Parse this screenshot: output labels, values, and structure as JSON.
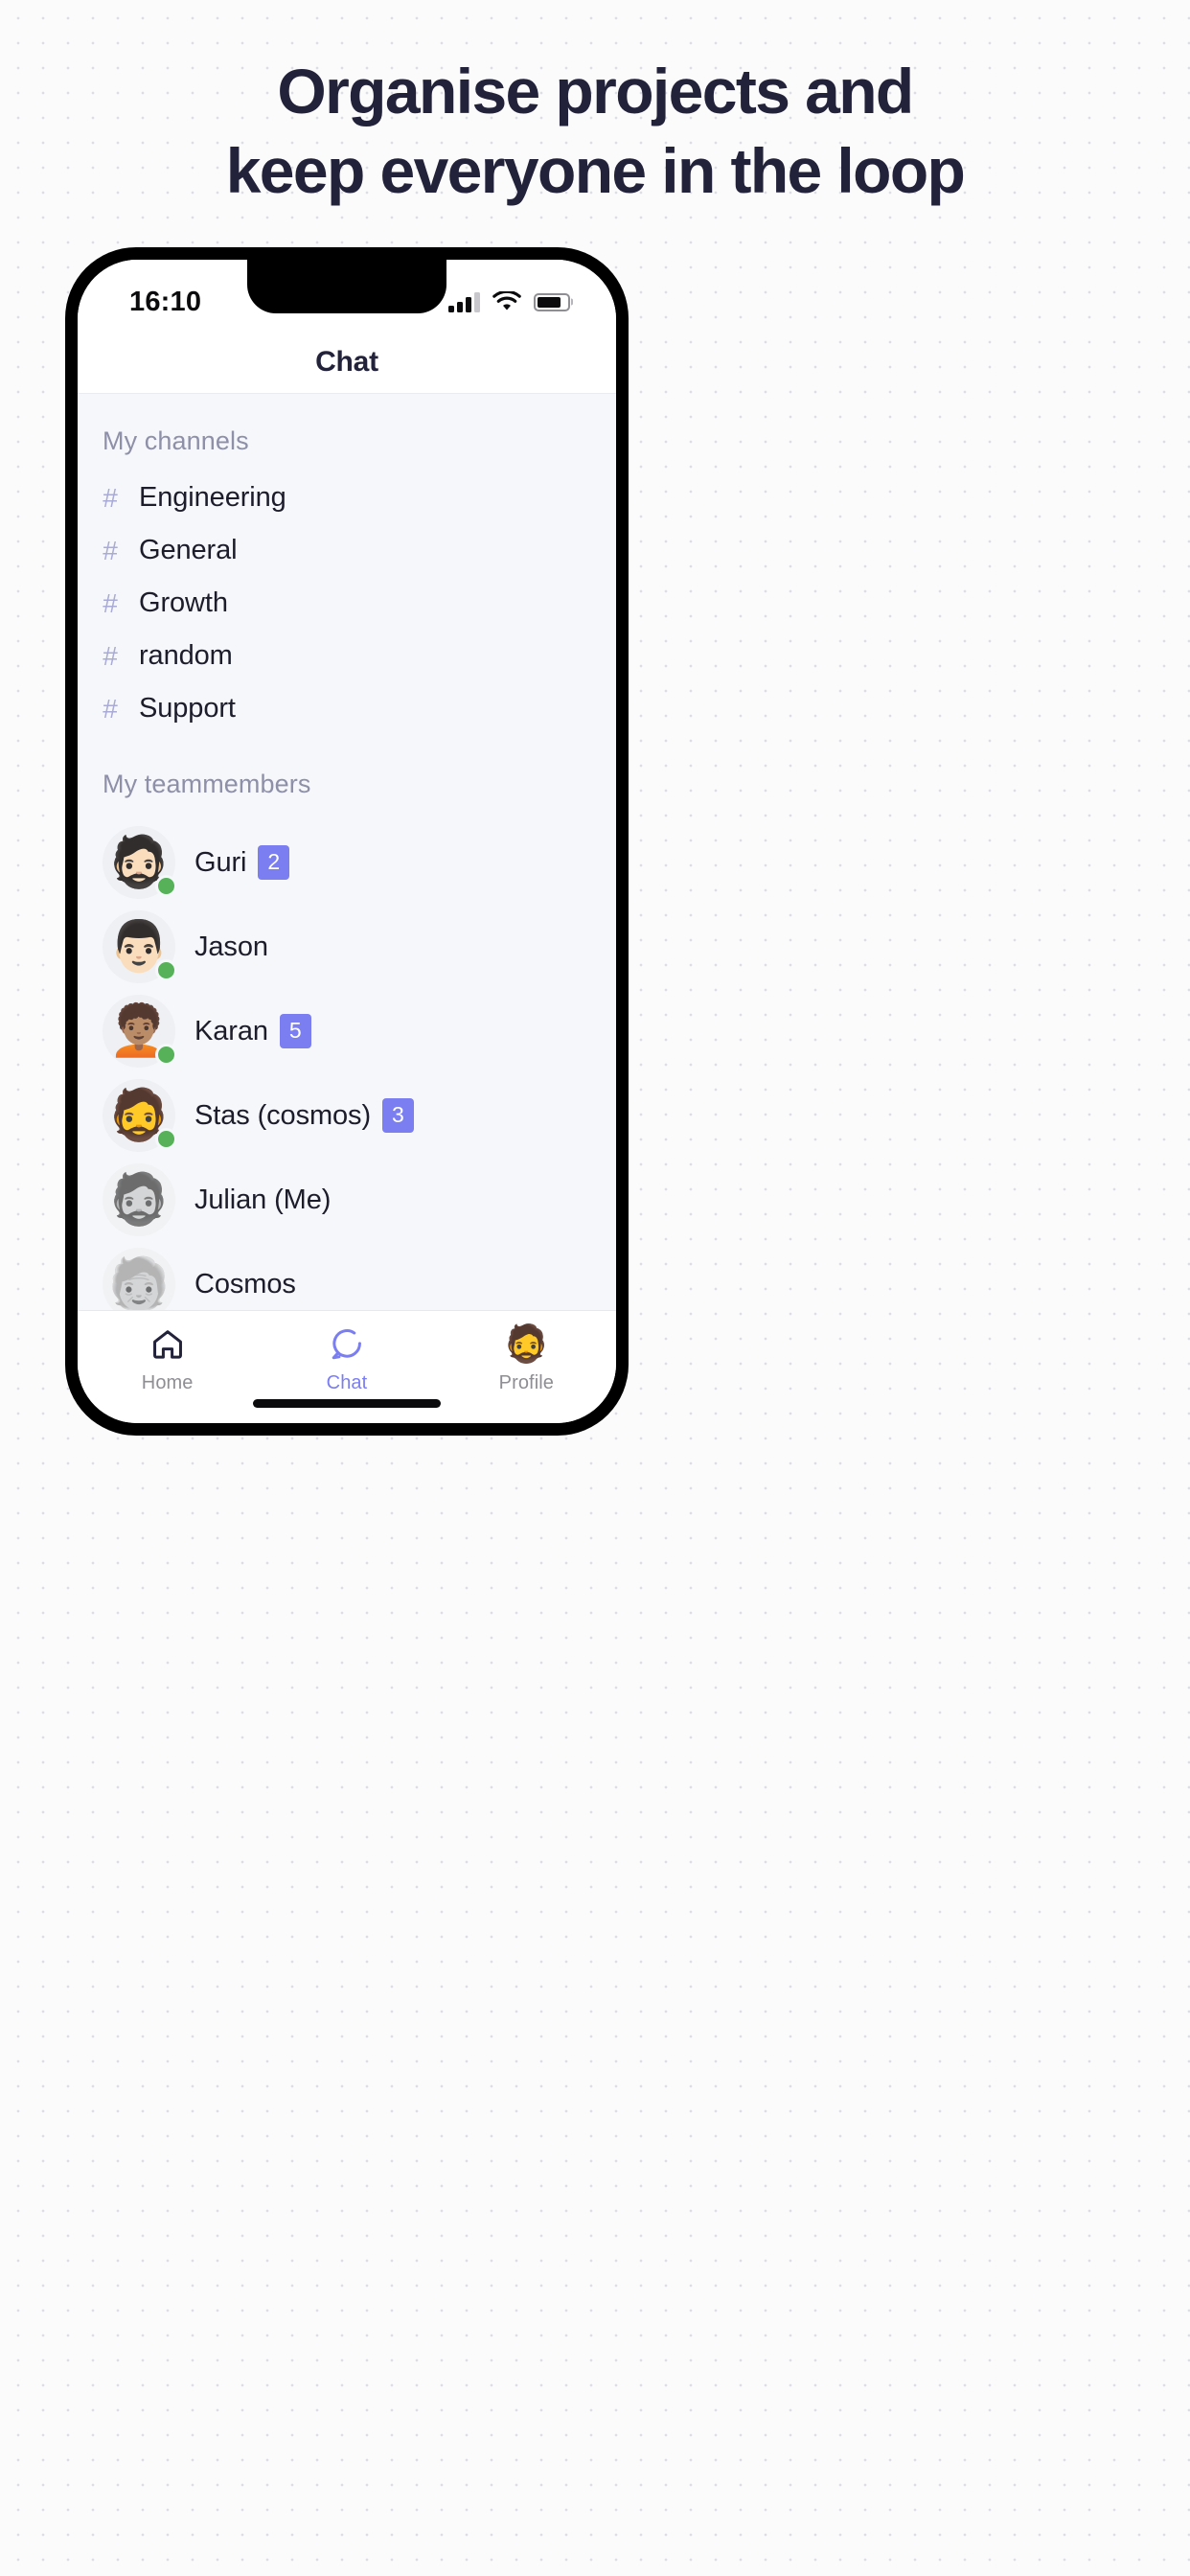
{
  "headline": {
    "line1": "Organise projects and",
    "line2": "keep everyone in the loop"
  },
  "colors": {
    "accent": "#7b7ef0",
    "headline_text": "#22223b",
    "content_bg": "#f5f7fb",
    "section_label": "#8e8fa8",
    "hash_icon": "#a9abd6",
    "online_dot": "#56b159",
    "badge_bg": "#7b7ef0",
    "page_bg": "#fbfbfc"
  },
  "status_bar": {
    "time": "16:10",
    "icons": [
      "signal-bars-icon",
      "wifi-icon",
      "battery-icon"
    ],
    "signal_bars_filled": 3,
    "signal_bars_total": 4,
    "battery_level_percent": 80
  },
  "nav": {
    "title": "Chat"
  },
  "sections": {
    "channels_label": "My channels",
    "teammembers_label": "My teammembers"
  },
  "channels": [
    {
      "icon": "hash-icon",
      "symbol": "#",
      "name": "Engineering"
    },
    {
      "icon": "hash-icon",
      "symbol": "#",
      "name": "General"
    },
    {
      "icon": "hash-icon",
      "symbol": "#",
      "name": "Growth"
    },
    {
      "icon": "hash-icon",
      "symbol": "#",
      "name": "random"
    },
    {
      "icon": "hash-icon",
      "symbol": "#",
      "name": "Support"
    }
  ],
  "teammembers": [
    {
      "name": "Guri",
      "badge": "2",
      "online": true,
      "avatar": "🧔🏻",
      "self": false
    },
    {
      "name": "Jason",
      "badge": "",
      "online": true,
      "avatar": "👨🏻",
      "self": false
    },
    {
      "name": "Karan",
      "badge": "5",
      "online": true,
      "avatar": "🧑🏽‍🦱",
      "self": false
    },
    {
      "name": "Stas (cosmos)",
      "badge": "3",
      "online": true,
      "avatar": "🧔",
      "self": false
    },
    {
      "name": "Julian (Me)",
      "badge": "",
      "online": false,
      "avatar": "🧔",
      "self": true
    },
    {
      "name": "Cosmos",
      "badge": "",
      "online": false,
      "avatar": "🧓",
      "self": false
    }
  ],
  "tabs": [
    {
      "label": "Home",
      "icon": "home-icon",
      "active": false
    },
    {
      "label": "Chat",
      "icon": "chat-bubble-icon",
      "active": true
    },
    {
      "label": "Profile",
      "icon": "profile-avatar-icon",
      "emoji": "🧔",
      "active": false
    }
  ]
}
